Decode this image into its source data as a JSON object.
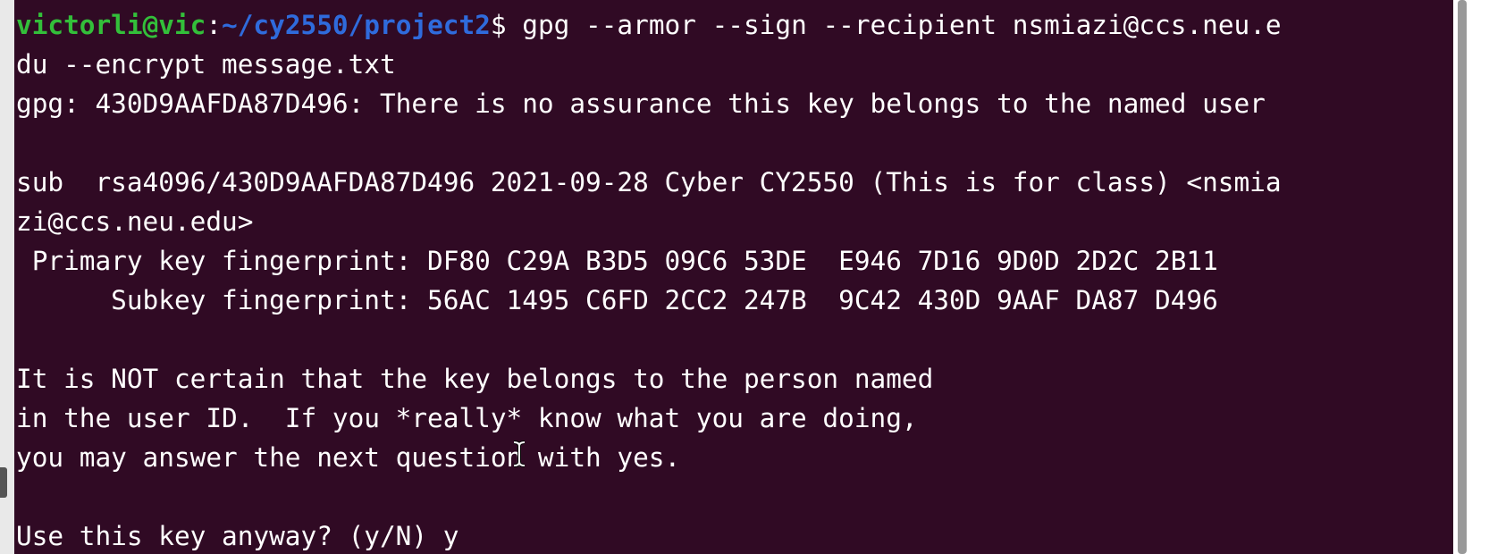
{
  "terminal": {
    "prompt": {
      "user_host": "victorli@vic",
      "separator": ":",
      "path": "~/cy2550/project2",
      "symbol": "$"
    },
    "command_part1": " gpg --armor --sign --recipient nsmiazi@ccs.neu.e",
    "command_part2": "du --encrypt message.txt",
    "output": [
      "gpg: 430D9AAFDA87D496: There is no assurance this key belongs to the named user",
      "",
      "sub  rsa4096/430D9AAFDA87D496 2021-09-28 Cyber CY2550 (This is for class) <nsmia",
      "zi@ccs.neu.edu>",
      " Primary key fingerprint: DF80 C29A B3D5 09C6 53DE  E946 7D16 9D0D 2D2C 2B11",
      "      Subkey fingerprint: 56AC 1495 C6FD 2CC2 247B  9C42 430D 9AAF DA87 D496",
      "",
      "It is NOT certain that the key belongs to the person named",
      "in the user ID.  If you *really* know what you are doing,",
      "you may answer the next question with yes.",
      "",
      "Use this key anyway? (y/N) y"
    ]
  },
  "icons": {
    "cursor": "text-cursor-icon"
  },
  "colors": {
    "background": "#300a24",
    "text": "#ffffff",
    "prompt_user": "#33bf3a",
    "prompt_path": "#2f6bdc"
  }
}
